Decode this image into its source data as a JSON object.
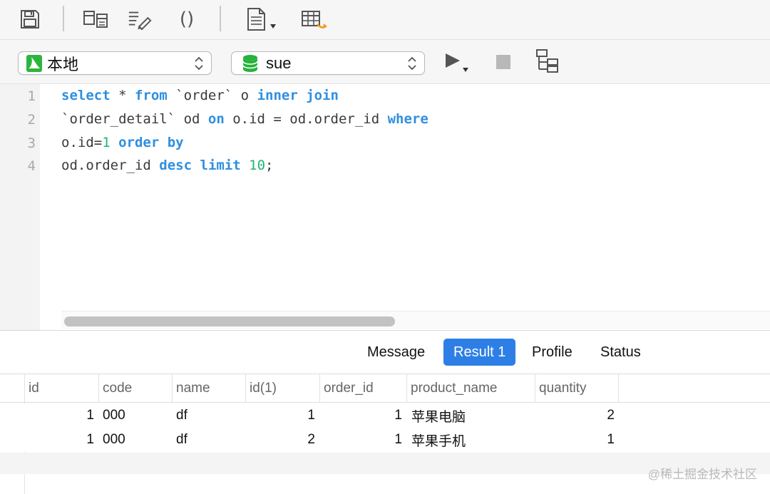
{
  "toolbar": {
    "icons": [
      "save-icon",
      "table-design-icon",
      "query-builder-icon",
      "parentheses-icon",
      "document-menu-icon",
      "export-table-icon"
    ],
    "parentheses_glyph": "()"
  },
  "connection_select": {
    "value": "本地"
  },
  "database_select": {
    "value": "sue"
  },
  "editor": {
    "line_numbers": [
      "1",
      "2",
      "3",
      "4"
    ],
    "lines": [
      [
        {
          "t": "select",
          "k": "kw"
        },
        {
          "t": " * ",
          "k": "txt"
        },
        {
          "t": "from",
          "k": "kw"
        },
        {
          "t": " `order` o ",
          "k": "txt"
        },
        {
          "t": "inner join",
          "k": "kw"
        }
      ],
      [
        {
          "t": "`order_detail` od ",
          "k": "txt"
        },
        {
          "t": "on",
          "k": "kw"
        },
        {
          "t": " o.id = od.order_id ",
          "k": "txt"
        },
        {
          "t": "where",
          "k": "kw"
        }
      ],
      [
        {
          "t": "o.id=",
          "k": "txt"
        },
        {
          "t": "1",
          "k": "num"
        },
        {
          "t": " ",
          "k": "txt"
        },
        {
          "t": "order by",
          "k": "kw"
        }
      ],
      [
        {
          "t": "od.order_id ",
          "k": "txt"
        },
        {
          "t": "desc",
          "k": "kw"
        },
        {
          "t": " ",
          "k": "txt"
        },
        {
          "t": "limit",
          "k": "kw"
        },
        {
          "t": " ",
          "k": "txt"
        },
        {
          "t": "10",
          "k": "num"
        },
        {
          "t": ";",
          "k": "txt"
        }
      ]
    ]
  },
  "result_tabs": [
    {
      "label": "Message",
      "active": false
    },
    {
      "label": "Result 1",
      "active": true
    },
    {
      "label": "Profile",
      "active": false
    },
    {
      "label": "Status",
      "active": false
    }
  ],
  "grid": {
    "columns": [
      "id",
      "code",
      "name",
      "id(1)",
      "order_id",
      "product_name",
      "quantity"
    ],
    "rows": [
      [
        "1",
        "000",
        "df",
        "1",
        "1",
        "苹果电脑",
        "2"
      ],
      [
        "1",
        "000",
        "df",
        "2",
        "1",
        "苹果手机",
        "1"
      ]
    ]
  },
  "watermark": "@稀土掘金技术社区",
  "colors": {
    "keyword": "#2f8fe0",
    "number": "#1fb56f",
    "active_tab": "#2d7fe6",
    "db_icon": "#27b23b"
  }
}
